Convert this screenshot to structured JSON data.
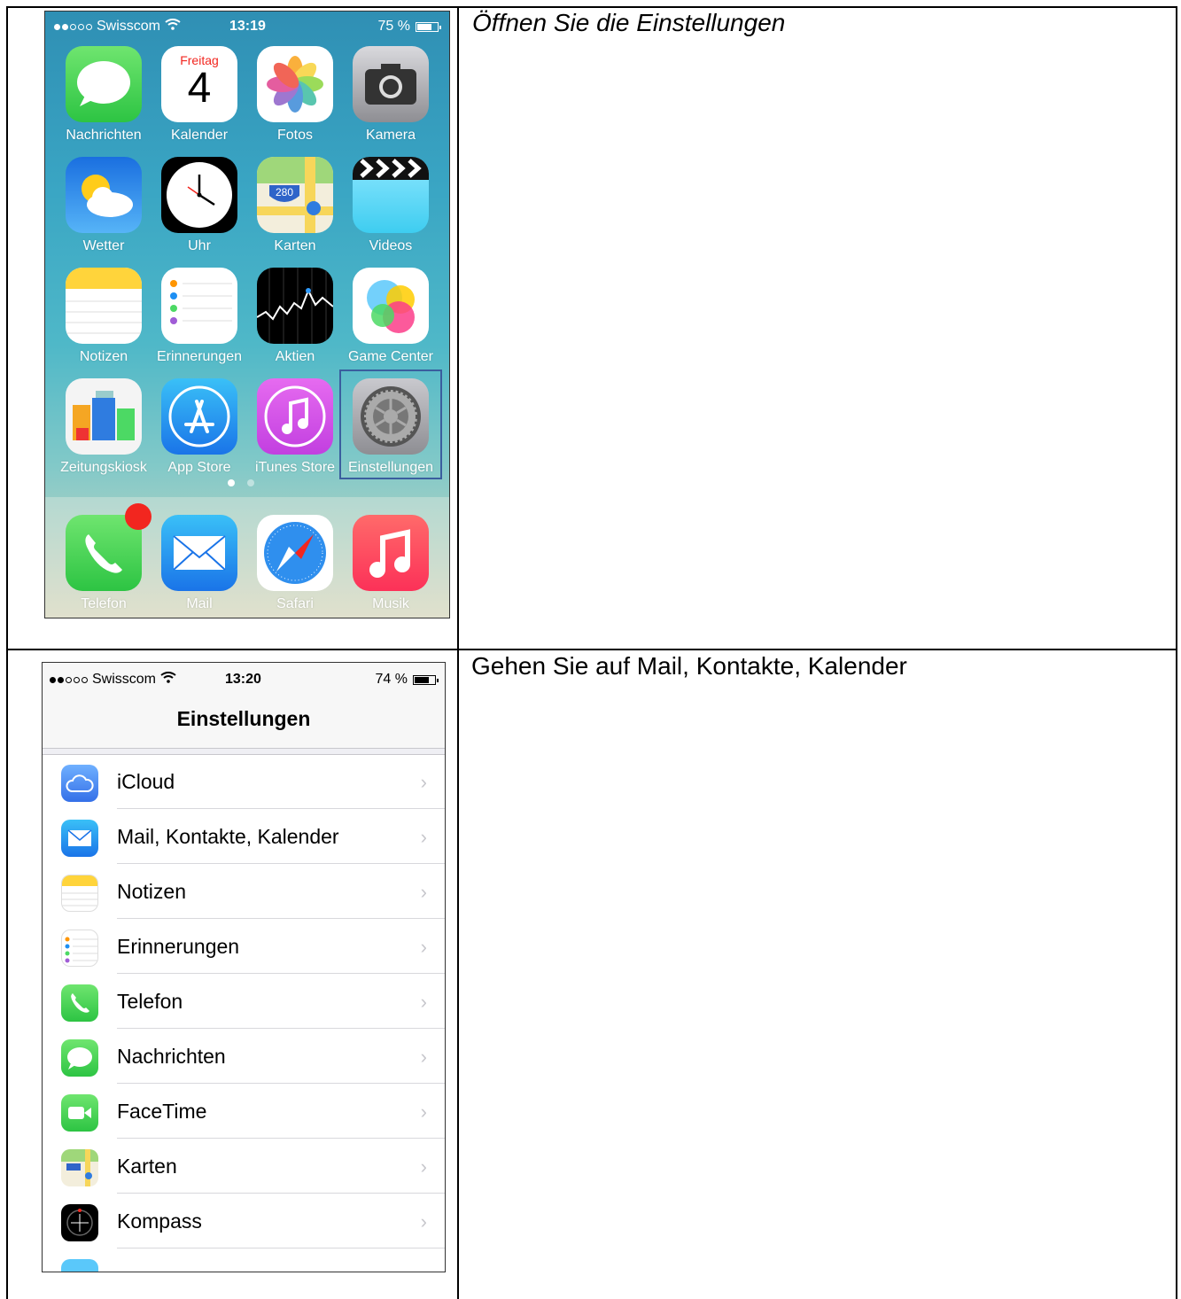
{
  "instructions": {
    "step1": "Öffnen Sie die Einstellungen",
    "step2": "Gehen Sie auf Mail, Kontakte, Kalender"
  },
  "home_screen": {
    "status_bar": {
      "carrier": "Swisscom",
      "time": "13:19",
      "battery": "75 %",
      "battery_level": 0.75
    },
    "calendar_day": "Freitag",
    "calendar_date": "4",
    "maps_shield": "280",
    "apps": [
      {
        "label": "Nachrichten",
        "icon": "messages-icon",
        "color": "#4cd964"
      },
      {
        "label": "Kalender",
        "icon": "calendar-icon",
        "color": "#ffffff"
      },
      {
        "label": "Fotos",
        "icon": "photos-icon",
        "color": "#ffffff"
      },
      {
        "label": "Kamera",
        "icon": "camera-icon",
        "color": "#8e8e93"
      },
      {
        "label": "Wetter",
        "icon": "weather-icon",
        "color": "#2b8ef0"
      },
      {
        "label": "Uhr",
        "icon": "clock-icon",
        "color": "#000000"
      },
      {
        "label": "Karten",
        "icon": "maps-icon",
        "color": "#f6f1e4"
      },
      {
        "label": "Videos",
        "icon": "videos-icon",
        "color": "#5ac8fa"
      },
      {
        "label": "Notizen",
        "icon": "notes-icon",
        "color": "#ffffff"
      },
      {
        "label": "Erinnerungen",
        "icon": "reminders-icon",
        "color": "#ffffff"
      },
      {
        "label": "Aktien",
        "icon": "stocks-icon",
        "color": "#000000"
      },
      {
        "label": "Game Center",
        "icon": "game-center-icon",
        "color": "#ffffff"
      },
      {
        "label": "Zeitungskiosk",
        "icon": "newsstand-icon",
        "color": "#ffffff"
      },
      {
        "label": "App Store",
        "icon": "app-store-icon",
        "color": "#1d8ff3"
      },
      {
        "label": "iTunes Store",
        "icon": "itunes-store-icon",
        "color": "#d34fe8"
      },
      {
        "label": "Einstellungen",
        "icon": "settings-gear-icon",
        "color": "#8e8e93"
      }
    ],
    "dock": [
      {
        "label": "Telefon",
        "icon": "phone-icon",
        "color": "#4cd964"
      },
      {
        "label": "Mail",
        "icon": "mail-icon",
        "color": "#1d8ff3"
      },
      {
        "label": "Safari",
        "icon": "safari-icon",
        "color": "#ffffff"
      },
      {
        "label": "Musik",
        "icon": "music-icon",
        "color": "#fc3158"
      }
    ]
  },
  "settings_screen": {
    "status_bar": {
      "carrier": "Swisscom",
      "time": "13:20",
      "battery": "74 %",
      "battery_level": 0.74
    },
    "title": "Einstellungen",
    "rows": [
      {
        "label": "iCloud",
        "icon": "icloud-icon"
      },
      {
        "label": "Mail, Kontakte, Kalender",
        "icon": "mail-icon"
      },
      {
        "label": "Notizen",
        "icon": "notes-icon"
      },
      {
        "label": "Erinnerungen",
        "icon": "reminders-icon"
      },
      {
        "label": "Telefon",
        "icon": "phone-icon"
      },
      {
        "label": "Nachrichten",
        "icon": "messages-icon"
      },
      {
        "label": "FaceTime",
        "icon": "facetime-icon"
      },
      {
        "label": "Karten",
        "icon": "maps-icon"
      },
      {
        "label": "Kompass",
        "icon": "compass-icon"
      }
    ]
  }
}
